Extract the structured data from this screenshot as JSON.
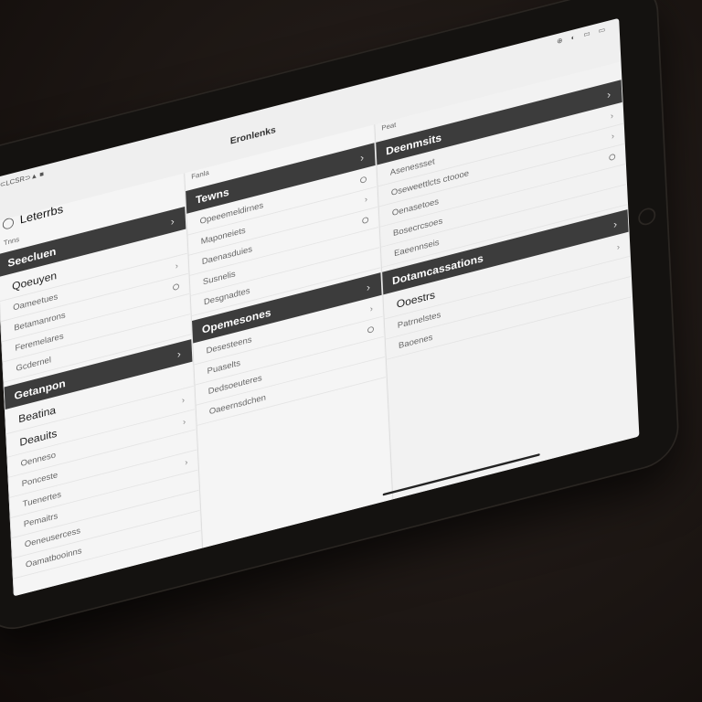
{
  "status_bar": {
    "left": "⊂LCSR⊃▲ ■",
    "right": "⊕ ◐ ▭ ▭"
  },
  "window_title": "Eronlenks",
  "col1": {
    "nav_title": "Leterrbs",
    "caption": "Tnns",
    "sections": [
      {
        "title": "Seecluen",
        "rows": [
          {
            "label": "Qoeuyen",
            "strong": true,
            "accessory": ""
          },
          {
            "label": "Oameetues",
            "strong": false,
            "accessory": "›"
          },
          {
            "label": "Betamanrons",
            "strong": false,
            "accessory": "○"
          },
          {
            "label": "Feremelares",
            "strong": false,
            "accessory": ""
          },
          {
            "label": "Gcdernel",
            "strong": false,
            "accessory": ""
          }
        ]
      },
      {
        "title": "Getanpon",
        "rows": [
          {
            "label": "Beatina",
            "strong": true,
            "accessory": ""
          },
          {
            "label": "Deauits",
            "strong": true,
            "accessory": "›"
          },
          {
            "label": "Oenneso",
            "strong": false,
            "accessory": "›"
          },
          {
            "label": "Ponceste",
            "strong": false,
            "accessory": ""
          },
          {
            "label": "Tuenertes",
            "strong": false,
            "accessory": "›"
          },
          {
            "label": "Pemaitrs",
            "strong": false,
            "accessory": ""
          },
          {
            "label": "Oeneusercess",
            "strong": false,
            "accessory": ""
          },
          {
            "label": "Oamatbooinns",
            "strong": false,
            "accessory": ""
          }
        ]
      }
    ]
  },
  "col2": {
    "caption": "Fanla",
    "sections": [
      {
        "title": "Tewns",
        "rows": [
          {
            "label": "Opeeemeldirnes",
            "strong": false,
            "accessory": "○"
          },
          {
            "label": "Maponeiets",
            "strong": false,
            "accessory": "›"
          },
          {
            "label": "Daenasduies",
            "strong": false,
            "accessory": "○"
          },
          {
            "label": "Susnelis",
            "strong": false,
            "accessory": ""
          },
          {
            "label": "Desgnadtes",
            "strong": false,
            "accessory": ""
          }
        ]
      },
      {
        "title": "Opemesones",
        "rows": [
          {
            "label": "Desesteens",
            "strong": false,
            "accessory": "›"
          },
          {
            "label": "Puaselts",
            "strong": false,
            "accessory": "○"
          },
          {
            "label": "Dedsoeuteres",
            "strong": false,
            "accessory": ""
          },
          {
            "label": "Oaeernsdchen",
            "strong": false,
            "accessory": ""
          }
        ]
      }
    ]
  },
  "col3": {
    "caption": "Peat",
    "sections": [
      {
        "title": "Deenmsits",
        "rows": [
          {
            "label": "Asenessset",
            "strong": false,
            "accessory": "›"
          },
          {
            "label": "Oseweettlcts ctoooe",
            "strong": false,
            "accessory": "›"
          },
          {
            "label": "Oenasetoes",
            "strong": false,
            "accessory": "○"
          },
          {
            "label": "Bosecrcsoes",
            "strong": false,
            "accessory": ""
          },
          {
            "label": "Eaeennseis",
            "strong": false,
            "accessory": ""
          }
        ]
      },
      {
        "title": "Dotamcassations",
        "rows": [
          {
            "label": "Ooestrs",
            "strong": true,
            "accessory": "›"
          },
          {
            "label": "Patrnelstes",
            "strong": false,
            "accessory": ""
          },
          {
            "label": "Baoenes",
            "strong": false,
            "accessory": ""
          }
        ]
      }
    ]
  },
  "colors": {
    "section_bar": "#3c3c3c",
    "screen_bg": "#efefef"
  }
}
